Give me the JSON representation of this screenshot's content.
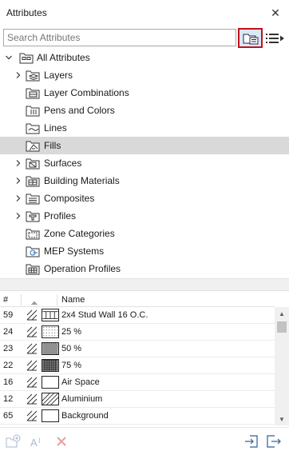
{
  "window": {
    "title": "Attributes"
  },
  "search": {
    "placeholder": "Search Attributes"
  },
  "tree": {
    "root": "All Attributes",
    "items": [
      {
        "label": "Layers",
        "expandable": true
      },
      {
        "label": "Layer Combinations",
        "expandable": false
      },
      {
        "label": "Pens and Colors",
        "expandable": false
      },
      {
        "label": "Lines",
        "expandable": false
      },
      {
        "label": "Fills",
        "expandable": false,
        "selected": true
      },
      {
        "label": "Surfaces",
        "expandable": true
      },
      {
        "label": "Building Materials",
        "expandable": true
      },
      {
        "label": "Composites",
        "expandable": true
      },
      {
        "label": "Profiles",
        "expandable": true
      },
      {
        "label": "Zone Categories",
        "expandable": false
      },
      {
        "label": "MEP Systems",
        "expandable": false
      },
      {
        "label": "Operation Profiles",
        "expandable": false
      }
    ]
  },
  "table": {
    "col_index": "#",
    "col_name": "Name",
    "rows": [
      {
        "index": "59",
        "name": "2x4 Stud Wall 16 O.C.",
        "pattern": "stud"
      },
      {
        "index": "24",
        "name": "25 %",
        "pattern": "dots-light"
      },
      {
        "index": "23",
        "name": "50 %",
        "pattern": "dots-medium"
      },
      {
        "index": "22",
        "name": "75 %",
        "pattern": "dots-dense"
      },
      {
        "index": "16",
        "name": "Air Space",
        "pattern": "empty"
      },
      {
        "index": "12",
        "name": "Aluminium",
        "pattern": "diagonal"
      },
      {
        "index": "65",
        "name": "Background",
        "pattern": "empty"
      }
    ]
  },
  "colors": {
    "highlight_border": "#c0111b",
    "selected_row": "#d9d9d9",
    "disabled_icon": "#a8b8cc",
    "delete_icon": "#e8a0a0"
  }
}
